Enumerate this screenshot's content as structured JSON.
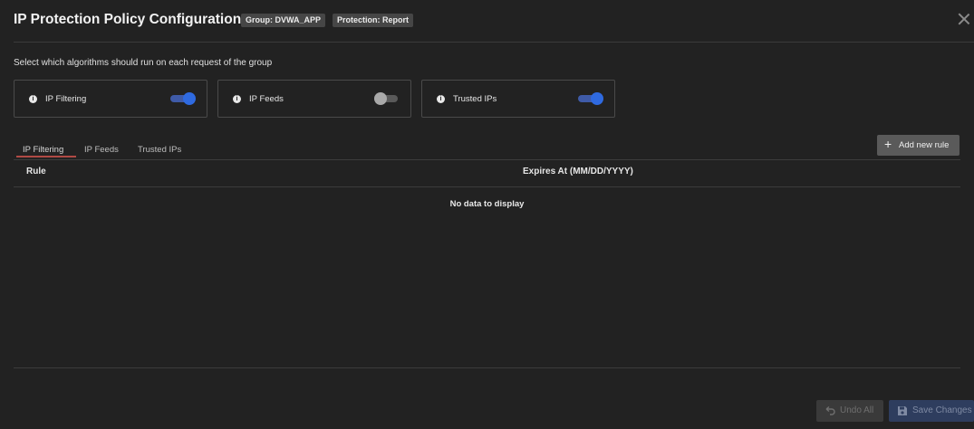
{
  "header": {
    "title": "IP Protection Policy Configuration",
    "group_badge": "Group: DVWA_APP",
    "protection_badge": "Protection: Report"
  },
  "instruction": "Select which algorithms should run on each request of the group",
  "algorithms": [
    {
      "label": "IP Filtering",
      "enabled": true
    },
    {
      "label": "IP Feeds",
      "enabled": false
    },
    {
      "label": "Trusted IPs",
      "enabled": true
    }
  ],
  "tabs": [
    {
      "label": "IP Filtering",
      "active": true
    },
    {
      "label": "IP Feeds",
      "active": false
    },
    {
      "label": "Trusted IPs",
      "active": false
    }
  ],
  "add_rule_label": "Add new rule",
  "table": {
    "columns": [
      "Rule",
      "Expires At (MM/DD/YYYY)"
    ],
    "empty_text": "No data to display"
  },
  "footer": {
    "undo_label": "Undo All",
    "save_label": "Save Changes"
  },
  "colors": {
    "background": "#222222",
    "toggle_on": "#2f6ae0",
    "active_tab_underline": "#b04a45"
  },
  "icons": [
    "info-icon",
    "close-icon",
    "plus-icon",
    "undo-icon",
    "save-icon"
  ]
}
